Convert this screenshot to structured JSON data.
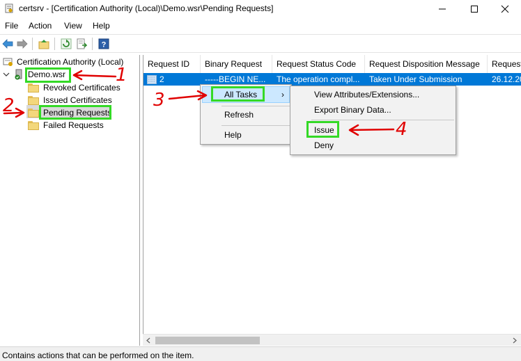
{
  "window": {
    "title": "certsrv - [Certification Authority (Local)\\Demo.wsr\\Pending Requests]"
  },
  "menubar": [
    "File",
    "Action",
    "View",
    "Help"
  ],
  "toolbar": {
    "icons": [
      "back-arrow-icon",
      "forward-arrow-icon",
      "up-folder-icon",
      "refresh-icon",
      "export-list-icon",
      "help-icon"
    ]
  },
  "tree": {
    "root": "Certification Authority (Local)",
    "server": "Demo.wsr",
    "folders": [
      "Revoked Certificates",
      "Issued Certificates",
      "Pending Requests",
      "Failed Requests"
    ]
  },
  "list": {
    "columns": [
      "Request ID",
      "Binary Request",
      "Request Status Code",
      "Request Disposition Message",
      "Request"
    ],
    "rows": [
      [
        "2",
        "-----BEGIN NE...",
        "The operation compl...",
        "Taken Under Submission",
        "26.12.20"
      ]
    ]
  },
  "context_menu": {
    "items": [
      "All Tasks",
      "Refresh",
      "Help"
    ],
    "submenu_arrow": "›"
  },
  "submenu": {
    "items": [
      "View Attributes/Extensions...",
      "Export Binary Data...",
      "Issue",
      "Deny"
    ]
  },
  "status": "Contains actions that can be performed on the item.",
  "annotations": {
    "numbers": [
      "1",
      "2",
      "3",
      "4"
    ],
    "color_box": "#34d926",
    "color_arrow": "#e00000"
  },
  "colors": {
    "selection": "#0078d7",
    "highlight": "#d9d9d9"
  }
}
